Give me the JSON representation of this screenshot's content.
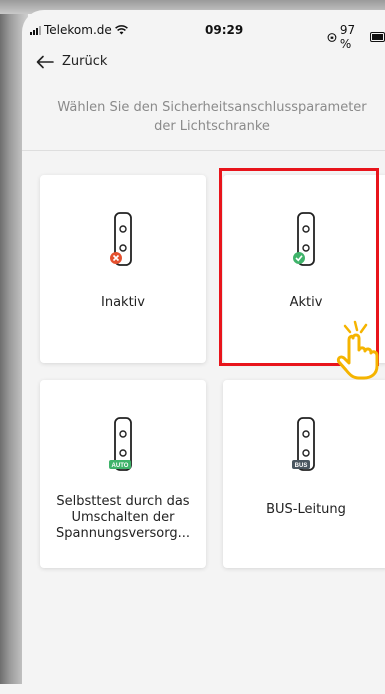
{
  "status_bar": {
    "carrier": "Telekom.de",
    "time": "09:29",
    "battery": "97 %"
  },
  "nav": {
    "back_label": "Zurück"
  },
  "subtitle": "Wählen Sie den Sicherheitsanschlussparameter der Lichtschranke",
  "options": [
    {
      "label": "Inaktiv",
      "badge": "x",
      "badge_color": "#e4502e"
    },
    {
      "label": "Aktiv",
      "badge": "check",
      "badge_color": "#3fb36a",
      "selected": true
    },
    {
      "label": "Selbsttest durch das Umschalten der Spannungsversorg...",
      "badge": "AUTO",
      "badge_color": "#3fb36a"
    },
    {
      "label": "BUS-Leitung",
      "badge": "BUS",
      "badge_color": "#4a5660"
    }
  ],
  "colors": {
    "highlight": "#e8141b",
    "pointer_hand": "#f5b400"
  }
}
